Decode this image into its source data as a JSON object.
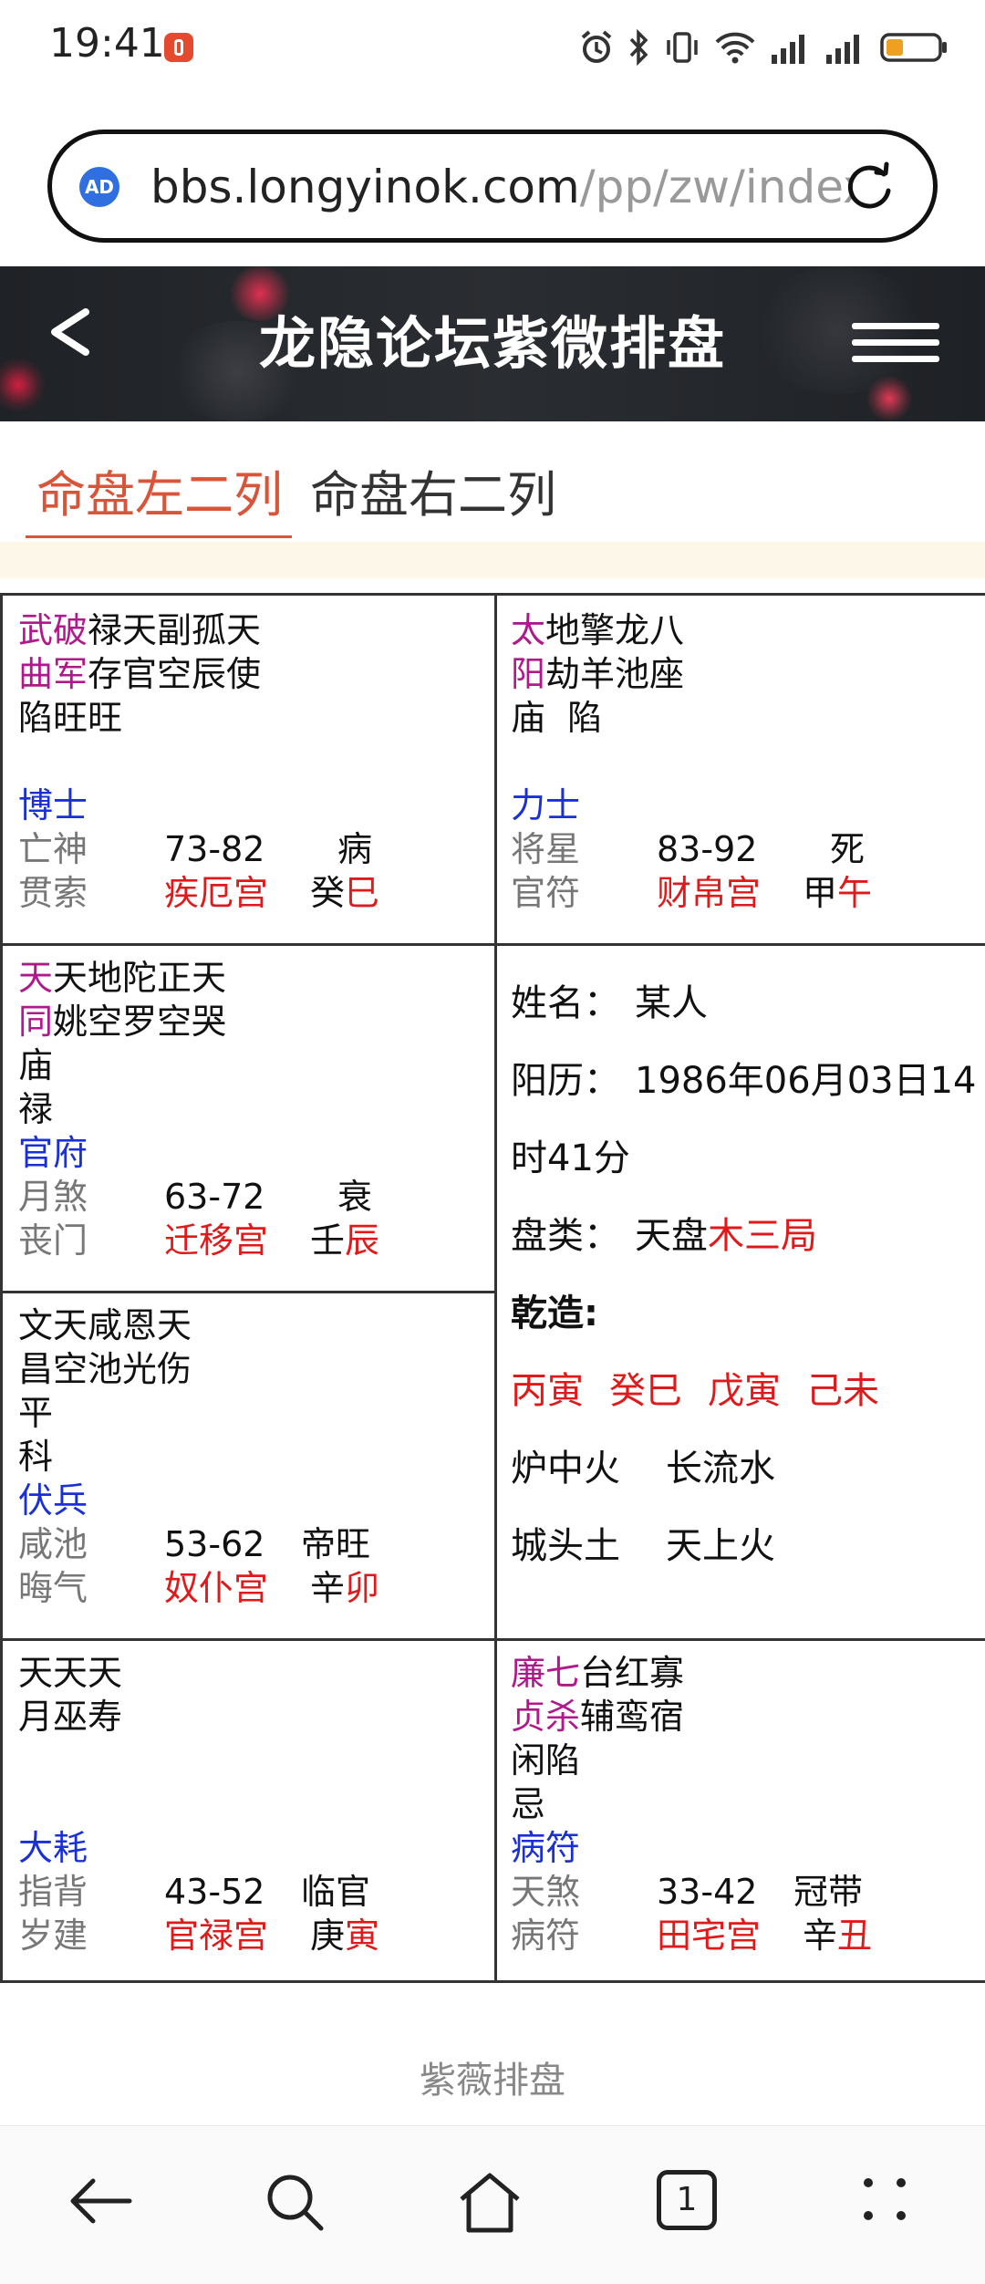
{
  "status_bar": {
    "time": "19:41",
    "icons": [
      "alarm-icon",
      "bluetooth-icon",
      "vibrate-icon",
      "wifi-icon",
      "signal-icon",
      "signal-icon",
      "battery-icon"
    ]
  },
  "browser": {
    "url_host": "bbs.longyinok.com",
    "url_path": "/pp/zw/index",
    "ad_badge": "AD"
  },
  "header": {
    "title": "龙隐论坛紫微排盘"
  },
  "tabs": [
    {
      "label": "命盘左二列",
      "active": true
    },
    {
      "label": "命盘右二列",
      "active": false
    }
  ],
  "palaces": [
    {
      "main": [
        "武破",
        "曲军"
      ],
      "minor": [
        "禄天副孤天",
        "存官空辰使"
      ],
      "extra": [
        "陷旺旺"
      ],
      "boshi": "博士",
      "col1": [
        "亡神",
        "贯索"
      ],
      "range": "73-82",
      "phase": "病",
      "palace": "疾厄宫",
      "stem": "癸",
      "branch": "巳"
    },
    {
      "main": [
        "太",
        "阳"
      ],
      "minor": [
        "地擎龙八",
        "劫羊池座"
      ],
      "extra": [
        "庙  陷"
      ],
      "boshi": "力士",
      "col1": [
        "将星",
        "官符"
      ],
      "range": "83-92",
      "phase": "死",
      "palace": "财帛宫",
      "stem": "甲",
      "branch": "午"
    },
    {
      "main": [
        "天",
        "同"
      ],
      "minor": [
        "天地陀正天",
        "姚空罗空哭"
      ],
      "extra": [
        "庙",
        "禄"
      ],
      "boshi": "官府",
      "col1": [
        "月煞",
        "丧门"
      ],
      "range": "63-72",
      "phase": "衰",
      "palace": "迁移宫",
      "stem": "壬",
      "branch": "辰"
    },
    {
      "main": [
        "",
        ""
      ],
      "minor": [
        "文天咸恩天",
        "昌空池光伤"
      ],
      "extra": [
        "平",
        "科"
      ],
      "boshi": "伏兵",
      "col1": [
        "咸池",
        "晦气"
      ],
      "range": "53-62",
      "phase": "帝旺",
      "palace": "奴仆宫",
      "stem": "辛",
      "branch": "卯"
    },
    {
      "main": [
        "",
        ""
      ],
      "minor": [
        "天天天",
        "月巫寿"
      ],
      "extra": [],
      "boshi": "大耗",
      "col1": [
        "指背",
        "岁建"
      ],
      "range": "43-52",
      "phase": "临官",
      "palace": "官禄宫",
      "stem": "庚",
      "branch": "寅"
    },
    {
      "main": [
        "廉七",
        "贞杀"
      ],
      "minor": [
        "台红寡",
        "辅鸾宿"
      ],
      "extra": [
        "闲陷",
        "忌"
      ],
      "boshi": "病符",
      "col1": [
        "天煞",
        "病符"
      ],
      "range": "33-42",
      "phase": "冠带",
      "palace": "田宅宫",
      "stem": "辛",
      "branch": "丑"
    }
  ],
  "info": {
    "name_label": "姓名：",
    "name": "某人",
    "solar_label": "阳历：",
    "solar_1": "1986年06月03日14",
    "solar_2": "时41分",
    "type_label": "盘类：",
    "type_value": "天盘",
    "type_ju": "木三局",
    "gender_label": "乾造:",
    "pillars": [
      "丙寅",
      "癸巳",
      "戊寅",
      "己未"
    ],
    "nayin_1": [
      "炉中火",
      "长流水"
    ],
    "nayin_2": [
      "城头土",
      "天上火"
    ]
  },
  "footer": {
    "text": "紫薇排盘"
  },
  "nav": {
    "tab_count": "1",
    "icons": [
      "back-arrow-icon",
      "search-icon",
      "home-icon",
      "tabs-icon",
      "more-icon"
    ]
  },
  "colors": {
    "accent": "#d9553a",
    "main_star": "#b0198c",
    "red": "#e01a1a",
    "blue": "#1a30d6"
  }
}
